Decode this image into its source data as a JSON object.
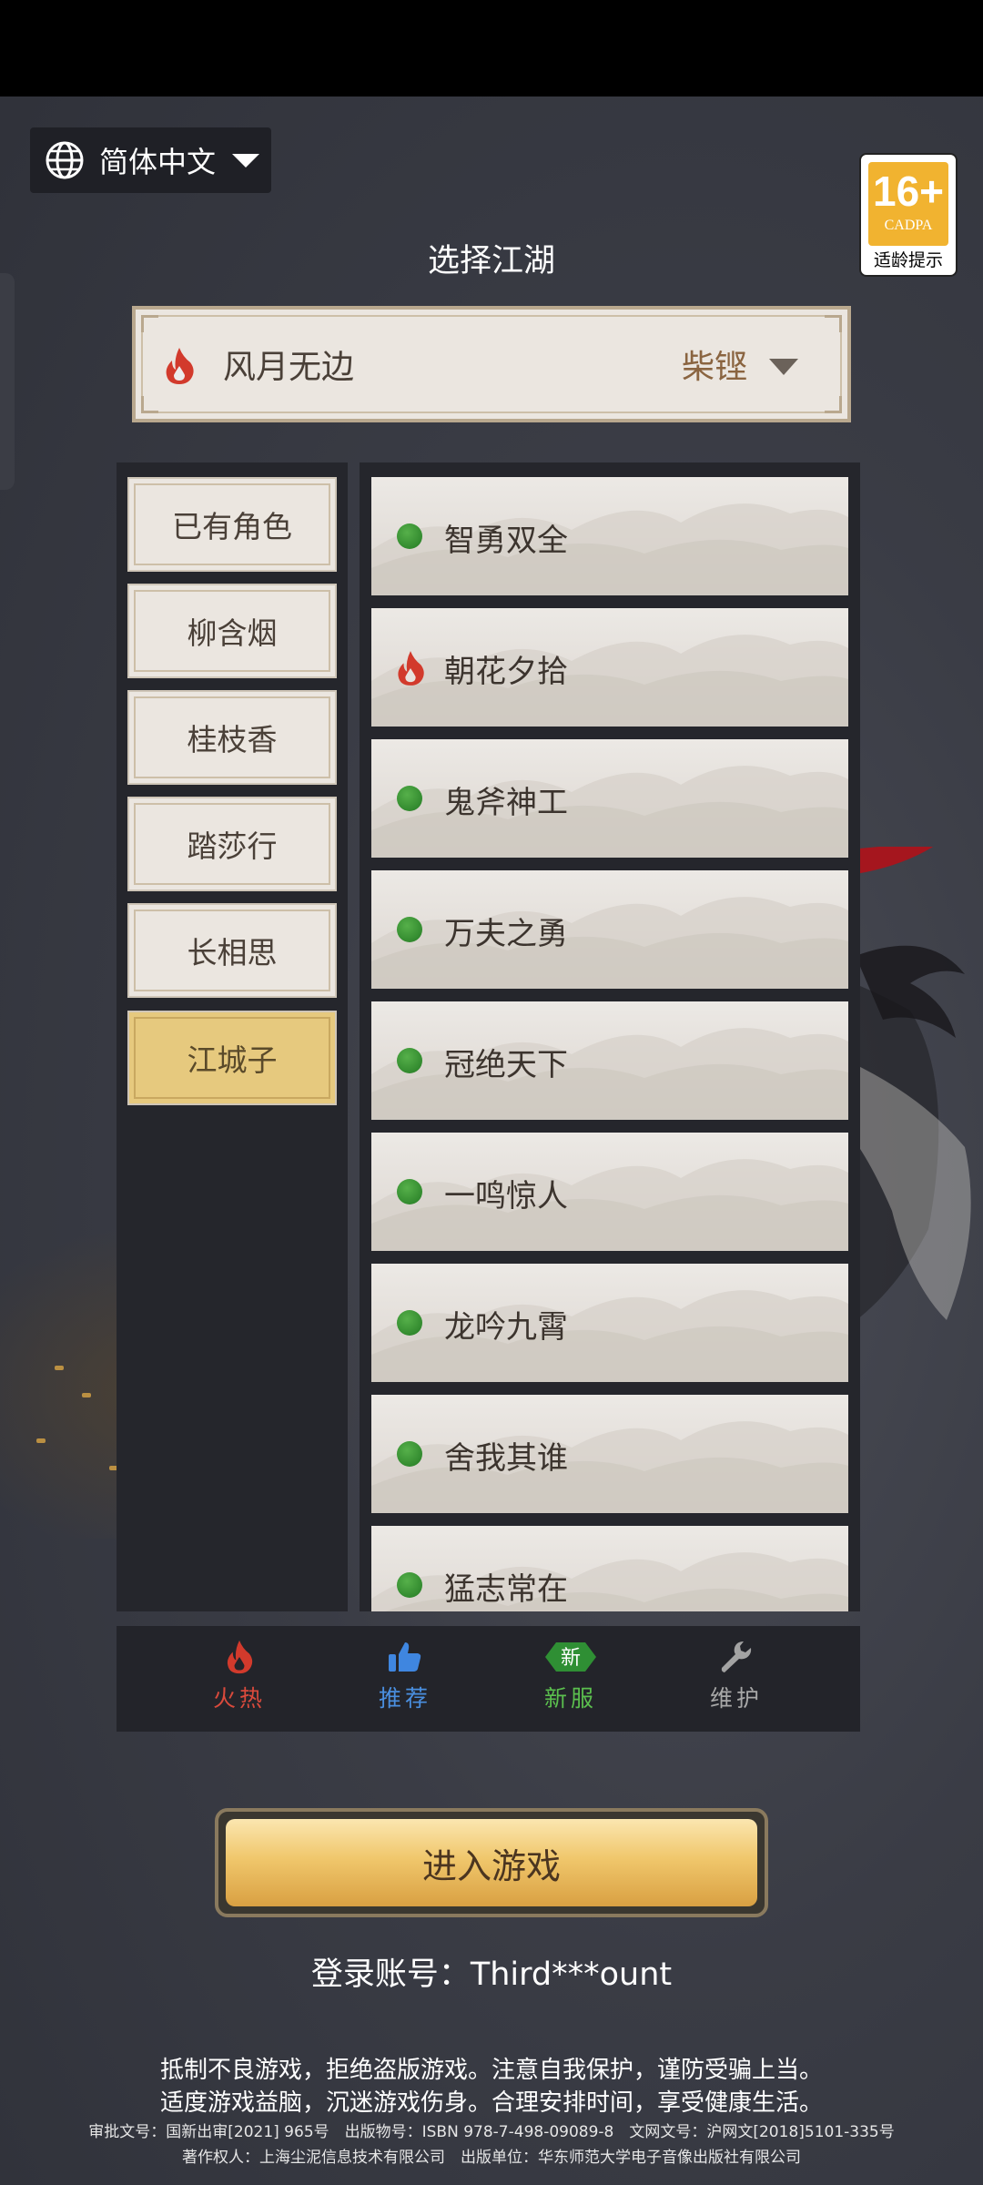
{
  "language": {
    "label": "简体中文",
    "icon": "globe-icon"
  },
  "age_rating": {
    "number": "16+",
    "org": "CADPA",
    "tip": "适龄提示"
  },
  "page_title": "选择江湖",
  "selected_server": {
    "name": "风月无边",
    "district": "柴铿",
    "status_icon": "fire-icon"
  },
  "categories": [
    {
      "label": "已有角色",
      "active": false
    },
    {
      "label": "柳含烟",
      "active": false
    },
    {
      "label": "桂枝香",
      "active": false
    },
    {
      "label": "踏莎行",
      "active": false
    },
    {
      "label": "长相思",
      "active": false
    },
    {
      "label": "江城子",
      "active": true
    }
  ],
  "servers": [
    {
      "name": "智勇双全",
      "status": "online"
    },
    {
      "name": "朝花夕拾",
      "status": "hot"
    },
    {
      "name": "鬼斧神工",
      "status": "online"
    },
    {
      "name": "万夫之勇",
      "status": "online"
    },
    {
      "name": "冠绝天下",
      "status": "online"
    },
    {
      "name": "一鸣惊人",
      "status": "online"
    },
    {
      "name": "龙吟九霄",
      "status": "online"
    },
    {
      "name": "舍我其谁",
      "status": "online"
    },
    {
      "name": "猛志常在",
      "status": "online"
    }
  ],
  "legend_tabs": [
    {
      "label": "火热",
      "icon": "fire-icon",
      "color": "#d94a3c"
    },
    {
      "label": "推荐",
      "icon": "thumbs-up-icon",
      "color": "#4a8fe0"
    },
    {
      "label": "新服",
      "icon": "new-badge-icon",
      "icon_text": "新",
      "color": "#5bbf4e"
    },
    {
      "label": "维护",
      "icon": "wrench-icon",
      "color": "#9a9a9a"
    }
  ],
  "enter_button": "进入游戏",
  "account": {
    "label": "登录账号：",
    "value": "Third***ount"
  },
  "notice": [
    "抵制不良游戏，拒绝盗版游戏。注意自我保护，谨防受骗上当。",
    "适度游戏益脑，沉迷游戏伤身。合理安排时间，享受健康生活。"
  ],
  "legal": [
    "审批文号：国新出审[2021] 965号　出版物号：ISBN 978-7-498-09089-8　文网文号：沪网文[2018]5101-335号",
    "著作权人：上海尘泥信息技术有限公司　出版单位：华东师范大学电子音像出版社有限公司"
  ]
}
